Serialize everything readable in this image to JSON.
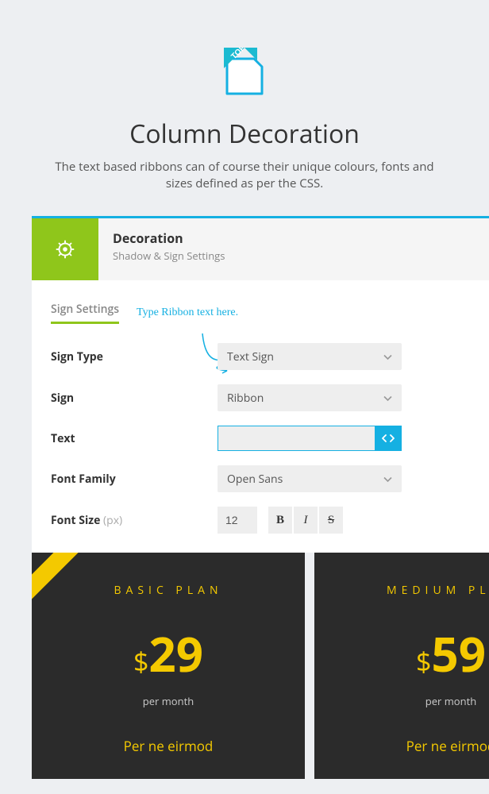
{
  "hero": {
    "title": "Column Decoration",
    "subtitle": "The text based ribbons can of course their unique colours, fonts and sizes defined as per the CSS.",
    "badge_text": "TOP"
  },
  "panel": {
    "title": "Decoration",
    "subtitle": "Shadow & Sign Settings",
    "tab": "Sign Settings",
    "annotation": "Type Ribbon text here.",
    "fields": {
      "sign_type": {
        "label": "Sign Type",
        "value": "Text Sign"
      },
      "sign": {
        "label": "Sign",
        "value": "Ribbon"
      },
      "text": {
        "label": "Text",
        "value": ""
      },
      "font_family": {
        "label": "Font Family",
        "value": "Open Sans"
      },
      "font_size": {
        "label": "Font Size",
        "hint": "(px)",
        "value": "12"
      }
    },
    "format": {
      "bold": "B",
      "italic": "I",
      "strike": "S"
    }
  },
  "plans": [
    {
      "name": "BASIC PLAN",
      "currency": "$",
      "amount": "29",
      "per": "per month",
      "desc": "Per ne eirmod"
    },
    {
      "name": "MEDIUM PLAN",
      "currency": "$",
      "amount": "59",
      "per": "per month",
      "desc": "Per ne eirmod"
    }
  ],
  "colors": {
    "accent": "#15b0e2",
    "green": "#8fc61b",
    "yellow": "#f4c900"
  }
}
